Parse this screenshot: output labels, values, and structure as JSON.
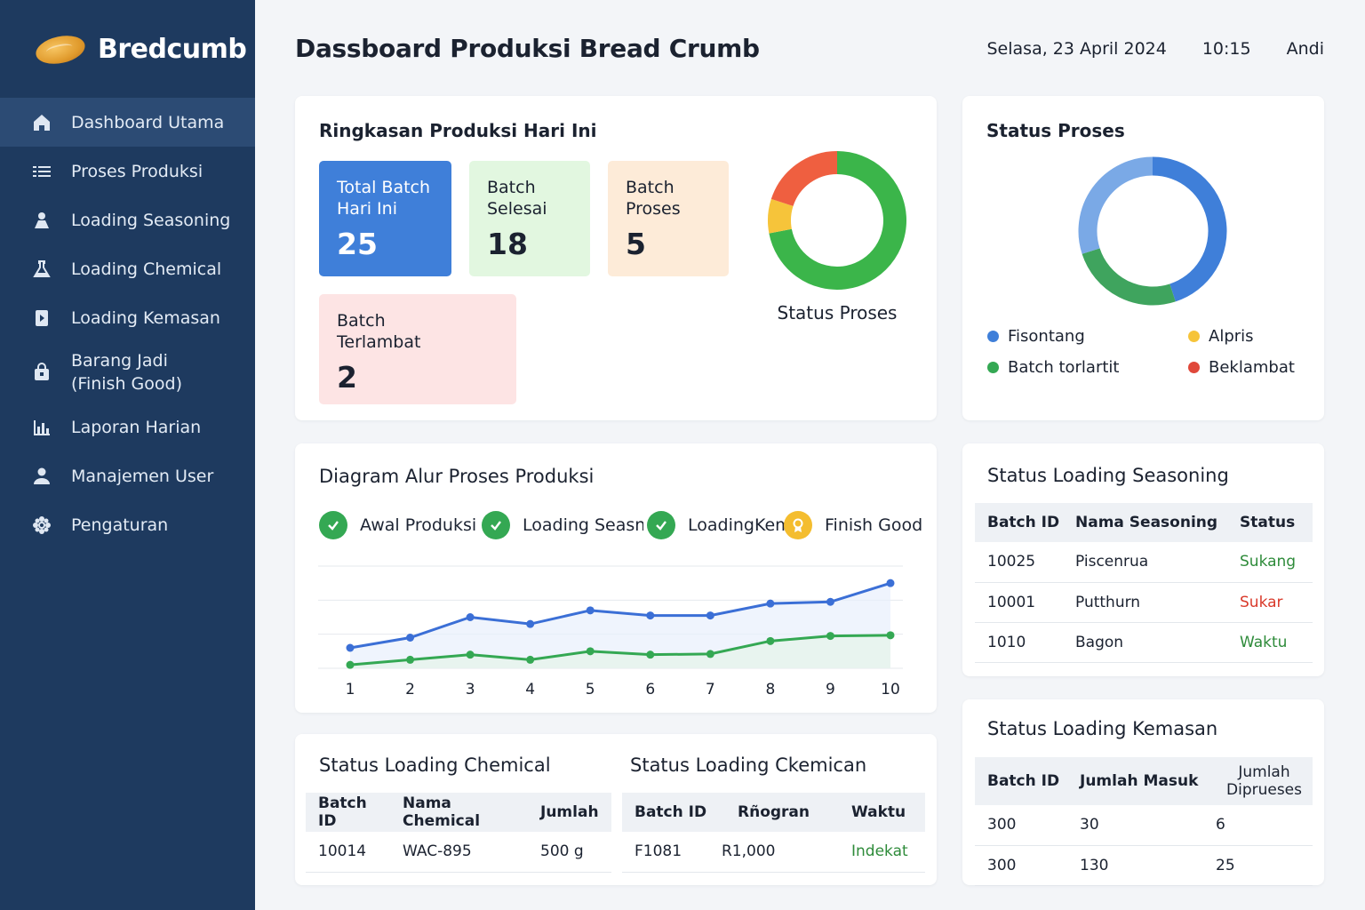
{
  "brand": {
    "name": "Bredcumb"
  },
  "sidebar": {
    "items": [
      {
        "label": "Dashboard Utama",
        "icon": "home-icon",
        "active": true
      },
      {
        "label": "Proses Produksi",
        "icon": "list-icon"
      },
      {
        "label": "Loading Seasoning",
        "icon": "chef-icon"
      },
      {
        "label": "Loading Chemical",
        "icon": "flask-icon"
      },
      {
        "label": "Loading Kemasan",
        "icon": "package-icon"
      },
      {
        "label": "Barang Jadi\n(Finish Good)",
        "icon": "bag-icon"
      },
      {
        "label": "Laporan Harian",
        "icon": "bar-chart-icon"
      },
      {
        "label": "Manajemen User",
        "icon": "user-icon"
      },
      {
        "label": "Pengaturan",
        "icon": "gear-icon"
      }
    ]
  },
  "header": {
    "title": "Dassboard Produksi Bread Crumb",
    "date": "Selasa, 23 April 2024",
    "time": "10:15",
    "user": "Andi"
  },
  "summary": {
    "title": "Ringkasan Produksi Hari Ini",
    "tiles": [
      {
        "label": "Total Batch\nHari Ini",
        "value": "25"
      },
      {
        "label": "Batch\nSelesai",
        "value": "18"
      },
      {
        "label": "Batch\nProses",
        "value": "5"
      },
      {
        "label": "Batch\nTerlambat",
        "value": "2"
      }
    ],
    "donut_label": "Status Proses",
    "donut": {
      "segments": [
        {
          "value": 18,
          "color": "#3bb54a"
        },
        {
          "value": 2,
          "color": "#f6c43a"
        },
        {
          "value": 5,
          "color": "#ef5f40"
        }
      ]
    }
  },
  "status_proses": {
    "title": "Status Proses",
    "donut": {
      "segments": [
        {
          "value": 45,
          "color": "#3f7fd9"
        },
        {
          "value": 25,
          "color": "#3fa45e"
        },
        {
          "value": 30,
          "color": "#7aa9e6"
        }
      ]
    },
    "legend": [
      {
        "label": "Fisontang",
        "color": "#3f7fd9"
      },
      {
        "label": "Alpris",
        "color": "#f6c43a"
      },
      {
        "label": "Batch torlartit",
        "color": "#34a853"
      },
      {
        "label": "Beklambat",
        "color": "#e0483a"
      }
    ]
  },
  "alur": {
    "title": "Diagram Alur Proses Produksi",
    "steps": [
      {
        "label": "Awal Produksi",
        "state": "done"
      },
      {
        "label": "Loading Seasni",
        "state": "done"
      },
      {
        "label": "LoadingKeme",
        "state": "done"
      },
      {
        "label": "Finish Good",
        "state": "pending"
      }
    ]
  },
  "chart_data": {
    "type": "line",
    "x": [
      1,
      2,
      3,
      4,
      5,
      6,
      7,
      8,
      9,
      10
    ],
    "ylim": [
      0,
      30
    ],
    "grid": true,
    "series": [
      {
        "values": [
          6,
          9,
          15,
          13,
          17,
          15.5,
          15.5,
          19,
          19.5,
          25
        ],
        "color": "#3b6fd6"
      },
      {
        "values": [
          1,
          2.5,
          4,
          2.5,
          5,
          4,
          4.2,
          8,
          9.5,
          9.7
        ],
        "color": "#34a853"
      }
    ]
  },
  "seasoning": {
    "title": "Status Loading Seasoning",
    "headers": [
      "Batch ID",
      "Nama Seasoning",
      "Status"
    ],
    "rows": [
      {
        "id": "10025",
        "name": "Piscenrua",
        "status": "Sukang",
        "tone": "green"
      },
      {
        "id": "10001",
        "name": "Putthurn",
        "status": "Sukar",
        "tone": "red"
      },
      {
        "id": "1010",
        "name": "Bagon",
        "status": "Waktu",
        "tone": "green"
      }
    ]
  },
  "chemical": {
    "title": "Status Loading Chemical",
    "headers": [
      "Batch ID",
      "Nama Chemical",
      "Jumlah"
    ],
    "rows": [
      {
        "id": "10014",
        "name": "WAC-895",
        "qty": "500 g"
      }
    ]
  },
  "ckemican": {
    "title": "Status Loading Ckemican",
    "headers": [
      "Batch ID",
      "Rñogran",
      "Waktu"
    ],
    "rows": [
      {
        "id": "F1081",
        "value": "R1,000",
        "status": "Indekat"
      }
    ]
  },
  "kemasan": {
    "title": "Status Loading Kemasan",
    "headers": [
      "Batch ID",
      "Jumlah Masuk",
      "Jumlah\nDipruesеs"
    ],
    "rows": [
      {
        "id": "300",
        "in": "30",
        "proc": "6"
      },
      {
        "id": "300",
        "in": "130",
        "proc": "25"
      }
    ]
  }
}
